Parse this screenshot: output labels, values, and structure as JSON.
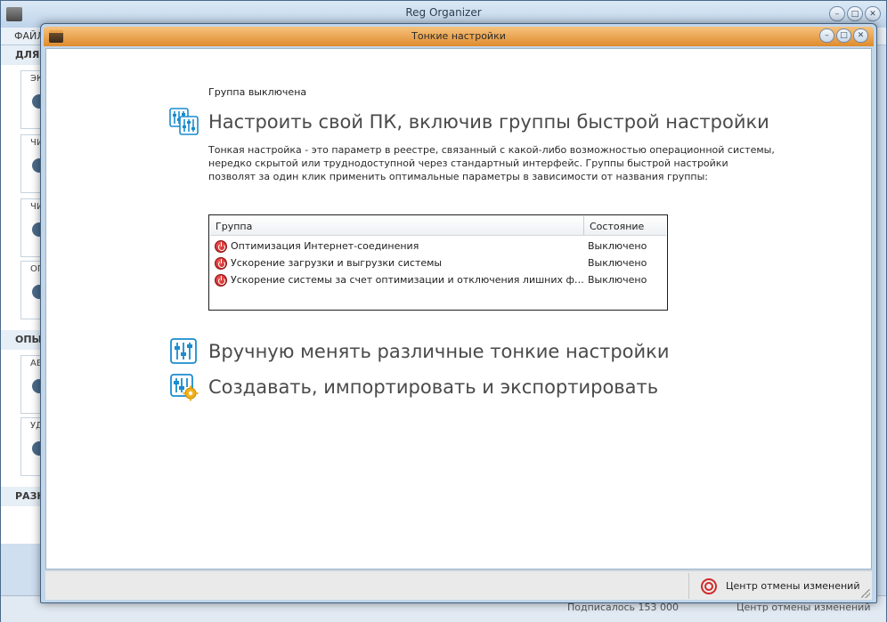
{
  "background_app": {
    "title": "Reg Organizer",
    "menu_label": "ФАЙЛ",
    "sections": [
      "ДЛЯ Б",
      "ОПЫТ",
      "РАЗН"
    ],
    "cards": [
      "ЭК",
      "ЧИ",
      "ЧИ",
      "ОП",
      "АВ",
      "УД"
    ],
    "status": {
      "subscribers": "Подписалось 153 000",
      "undo_center": "Центр отмены изменений"
    }
  },
  "dialog": {
    "title": "Тонкие настройки",
    "status_line": "Группа выключена",
    "quick_setup": {
      "heading": "Настроить свой ПК, включив группы быстрой настройки",
      "description": "Тонкая настройка - это параметр в реестре, связанный с какой-либо возможностью операционной системы, нередко скрытой или труднодоступной через стандартный интерфейс. Группы быстрой настройки позволят за один клик применить оптимальные параметры в зависимости от названия группы:"
    },
    "table": {
      "columns": [
        "Группа",
        "Состояние"
      ],
      "rows": [
        {
          "group": "Оптимизация Интернет-соединения",
          "state": "Выключено"
        },
        {
          "group": "Ускорение загрузки и выгрузки системы",
          "state": "Выключено"
        },
        {
          "group": "Ускорение системы за счет оптимизации и отключения лишних функций",
          "state": "Выключено"
        }
      ]
    },
    "manual": {
      "heading": "Вручную менять различные тонкие настройки"
    },
    "create": {
      "heading": "Создавать, импортировать и экспортировать"
    },
    "footer": {
      "undo_center": "Центр отмены изменений"
    }
  },
  "colors": {
    "dialog_title_top": "#f6c27e",
    "dialog_title_bottom": "#e08b2d",
    "icon_blue": "#1a8ccf",
    "state_off": "#c41e1e"
  }
}
